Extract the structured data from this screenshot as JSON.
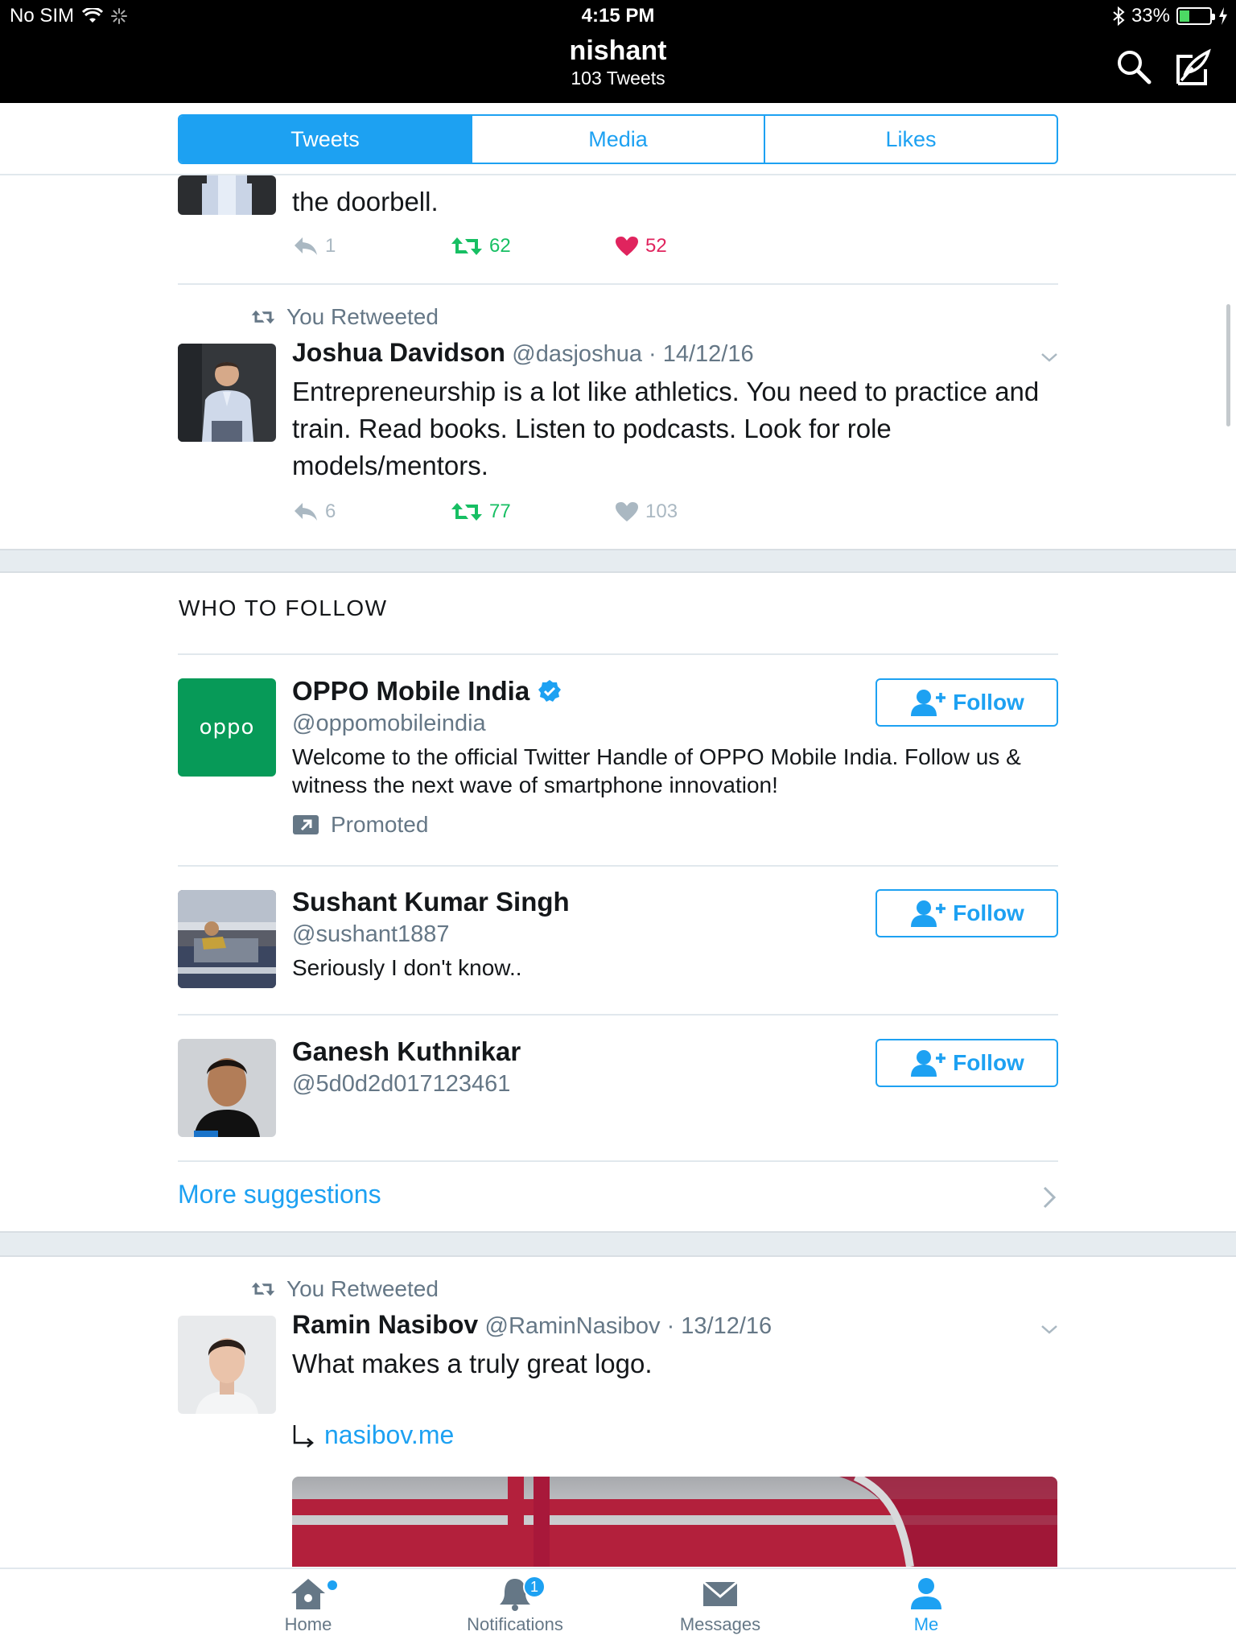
{
  "status_bar": {
    "carrier": "No SIM",
    "time": "4:15 PM",
    "battery": "33%",
    "battery_level": 0.33
  },
  "header": {
    "title": "nishant",
    "subtitle": "103 Tweets",
    "search_icon": "search-icon",
    "compose_icon": "compose-icon"
  },
  "segments": [
    {
      "label": "Tweets",
      "active": true
    },
    {
      "label": "Media",
      "active": false
    },
    {
      "label": "Likes",
      "active": false
    }
  ],
  "tweet_partial": {
    "text": "the doorbell.",
    "replies": "1",
    "retweets": "62",
    "likes": "52"
  },
  "tweet_joshua": {
    "context": "You Retweeted",
    "name": "Joshua Davidson",
    "meta": "@dasjoshua · 14/12/16",
    "text": "Entrepreneurship is a lot like athletics. You need to practice and train. Read books. Listen to podcasts. Look for role models/mentors.",
    "replies": "6",
    "retweets": "77",
    "likes": "103"
  },
  "who_to_follow": {
    "title": "WHO TO FOLLOW",
    "follow_label": "Follow",
    "accounts": [
      {
        "name": "OPPO Mobile India",
        "handle": "@oppomobileindia",
        "bio": "Welcome to the official Twitter Handle of OPPO Mobile India. Follow us & witness the next wave of smartphone innovation!",
        "promoted": "Promoted",
        "logo_text": "oppo"
      },
      {
        "name": "Sushant Kumar Singh",
        "handle": "@sushant1887",
        "bio": "Seriously I don't know.."
      },
      {
        "name": "Ganesh Kuthnikar",
        "handle": "@5d0d2d017123461",
        "bio": ""
      }
    ],
    "more": "More suggestions"
  },
  "tweet_ramin": {
    "context": "You Retweeted",
    "name": "Ramin Nasibov",
    "meta": "@RaminNasibov · 13/12/16",
    "text": "What makes a truly great logo.",
    "link": "nasibov.me"
  },
  "tabbar": {
    "items": [
      {
        "label": "Home"
      },
      {
        "label": "Notifications",
        "badge": "1"
      },
      {
        "label": "Messages"
      },
      {
        "label": "Me",
        "active": true
      }
    ]
  },
  "colors": {
    "accent": "#1da1f2",
    "retweet": "#17bf63",
    "like": "#e0245e",
    "muted": "#657786",
    "oppo_green": "#079a58"
  }
}
